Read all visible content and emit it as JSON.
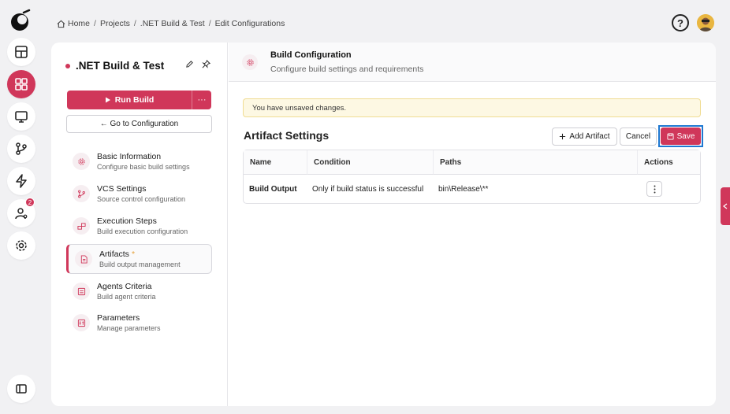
{
  "breadcrumb": {
    "items": [
      "Home",
      "Projects",
      ".NET Build & Test",
      "Edit Configurations"
    ],
    "separator": "/"
  },
  "rail": {
    "badge_count": "2",
    "accent": "#d0375a"
  },
  "project": {
    "title": ".NET Build & Test",
    "run_label": "Run Build",
    "more_label": "···",
    "goto_label": "← Go to Configuration"
  },
  "nav": [
    {
      "title": "Basic Information",
      "subtitle": "Configure basic build settings",
      "icon": "gear-icon"
    },
    {
      "title": "VCS Settings",
      "subtitle": "Source control configuration",
      "icon": "branch-icon"
    },
    {
      "title": "Execution Steps",
      "subtitle": "Build execution configuration",
      "icon": "steps-icon"
    },
    {
      "title": "Artifacts",
      "subtitle": "Build output management",
      "icon": "file-icon",
      "modified_mark": "*"
    },
    {
      "title": "Agents Criteria",
      "subtitle": "Build agent criteria",
      "icon": "agent-icon"
    },
    {
      "title": "Parameters",
      "subtitle": "Manage parameters",
      "icon": "params-icon"
    }
  ],
  "header": {
    "title": "Build Configuration",
    "subtitle": "Configure build settings and requirements"
  },
  "warning": "You have unsaved changes.",
  "section": {
    "title": "Artifact Settings",
    "add_label": "Add Artifact",
    "cancel_label": "Cancel",
    "save_label": "Save"
  },
  "table": {
    "columns": [
      "Name",
      "Condition",
      "Paths",
      "Actions"
    ],
    "rows": [
      {
        "name": "Build Output",
        "condition": "Only if build status is successful",
        "paths": "bin\\Release\\**"
      }
    ]
  }
}
